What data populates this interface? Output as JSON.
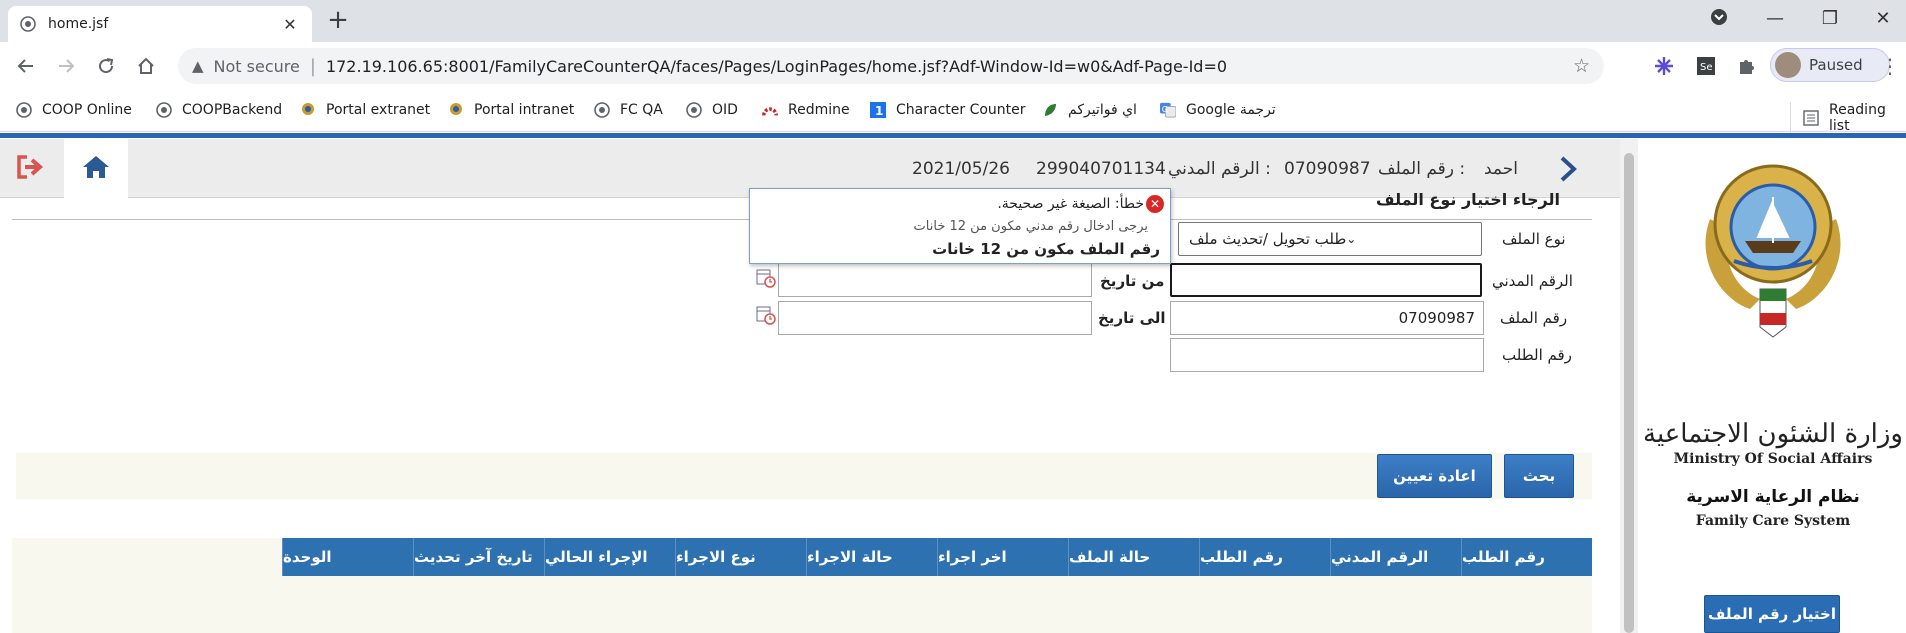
{
  "browser": {
    "tab_title": "home.jsf",
    "not_secure": "Not secure",
    "url": "172.19.106.65:8001/FamilyCareCounterQA/faces/Pages/LoginPages/home.jsf?Adf-Window-Id=w0&Adf-Page-Id=0",
    "profile_status": "Paused",
    "bookmarks": [
      {
        "label": "COOP Online",
        "icon": "globe-icon"
      },
      {
        "label": "COOPBackend",
        "icon": "globe-icon"
      },
      {
        "label": "Portal extranet",
        "icon": "emblem-icon"
      },
      {
        "label": "Portal intranet",
        "icon": "emblem-icon"
      },
      {
        "label": "FC QA",
        "icon": "globe-icon"
      },
      {
        "label": "OID",
        "icon": "globe-icon"
      },
      {
        "label": "Redmine",
        "icon": "redmine-icon"
      },
      {
        "label": "Character Counter",
        "icon": "number-one-icon"
      },
      {
        "label": "اي فواتيركم",
        "icon": "leaf-icon"
      },
      {
        "label": "Google ترجمة",
        "icon": "translate-icon"
      }
    ],
    "reading_list": "Reading list"
  },
  "header": {
    "name": "احمد",
    "file_label": "رقم الملف :",
    "file_value": "07090987",
    "civil_label": "الرقم المدني :",
    "civil_value": "299040701134",
    "date": "2021/05/26"
  },
  "form": {
    "title": "الرجاء اختيار نوع الملف",
    "file_type_label": "نوع الملف",
    "file_type_value": "طلب تحويل /تحديث ملف",
    "civil_id_label": "الرقم المدني",
    "civil_id_value": "",
    "file_no_label": "رقم الملف",
    "file_no_value": "07090987",
    "request_no_label": "رقم الطلب",
    "request_no_value": "",
    "from_date_label": "من تاريخ",
    "to_date_label": "الى تاريخ",
    "search_button": "بحث",
    "reset_button": "اعادة تعيين"
  },
  "error_popup": {
    "title": "خطأ: الصيغة غير صحيحة.",
    "detail": "يرجى ادخال رقم مدني مكون من 12 خانات",
    "message": "رقم الملف مكون من 12 خانات"
  },
  "grid": {
    "columns": [
      "رقم الطلب",
      "الرقم المدني",
      "رقم الطلب",
      "حالة الملف",
      "اخر اجراء",
      "حالة الاجراء",
      "نوع الاجراء",
      "الإجراء الحالي",
      "تاريخ آخر تحديث",
      "الوحدة"
    ]
  },
  "sidebar": {
    "ministry_ar": "وزارة الشئون الاجتماعية",
    "ministry_en": "Ministry Of Social Affairs",
    "system_ar": "نظام الرعاية الاسرية",
    "system_en": "Family Care System",
    "select_file_button": "اختيار رقم الملف"
  },
  "colors": {
    "accent": "#2d71b1",
    "error": "#d72828",
    "header_bg": "#ececec",
    "band_bg": "#f8f8ee"
  }
}
